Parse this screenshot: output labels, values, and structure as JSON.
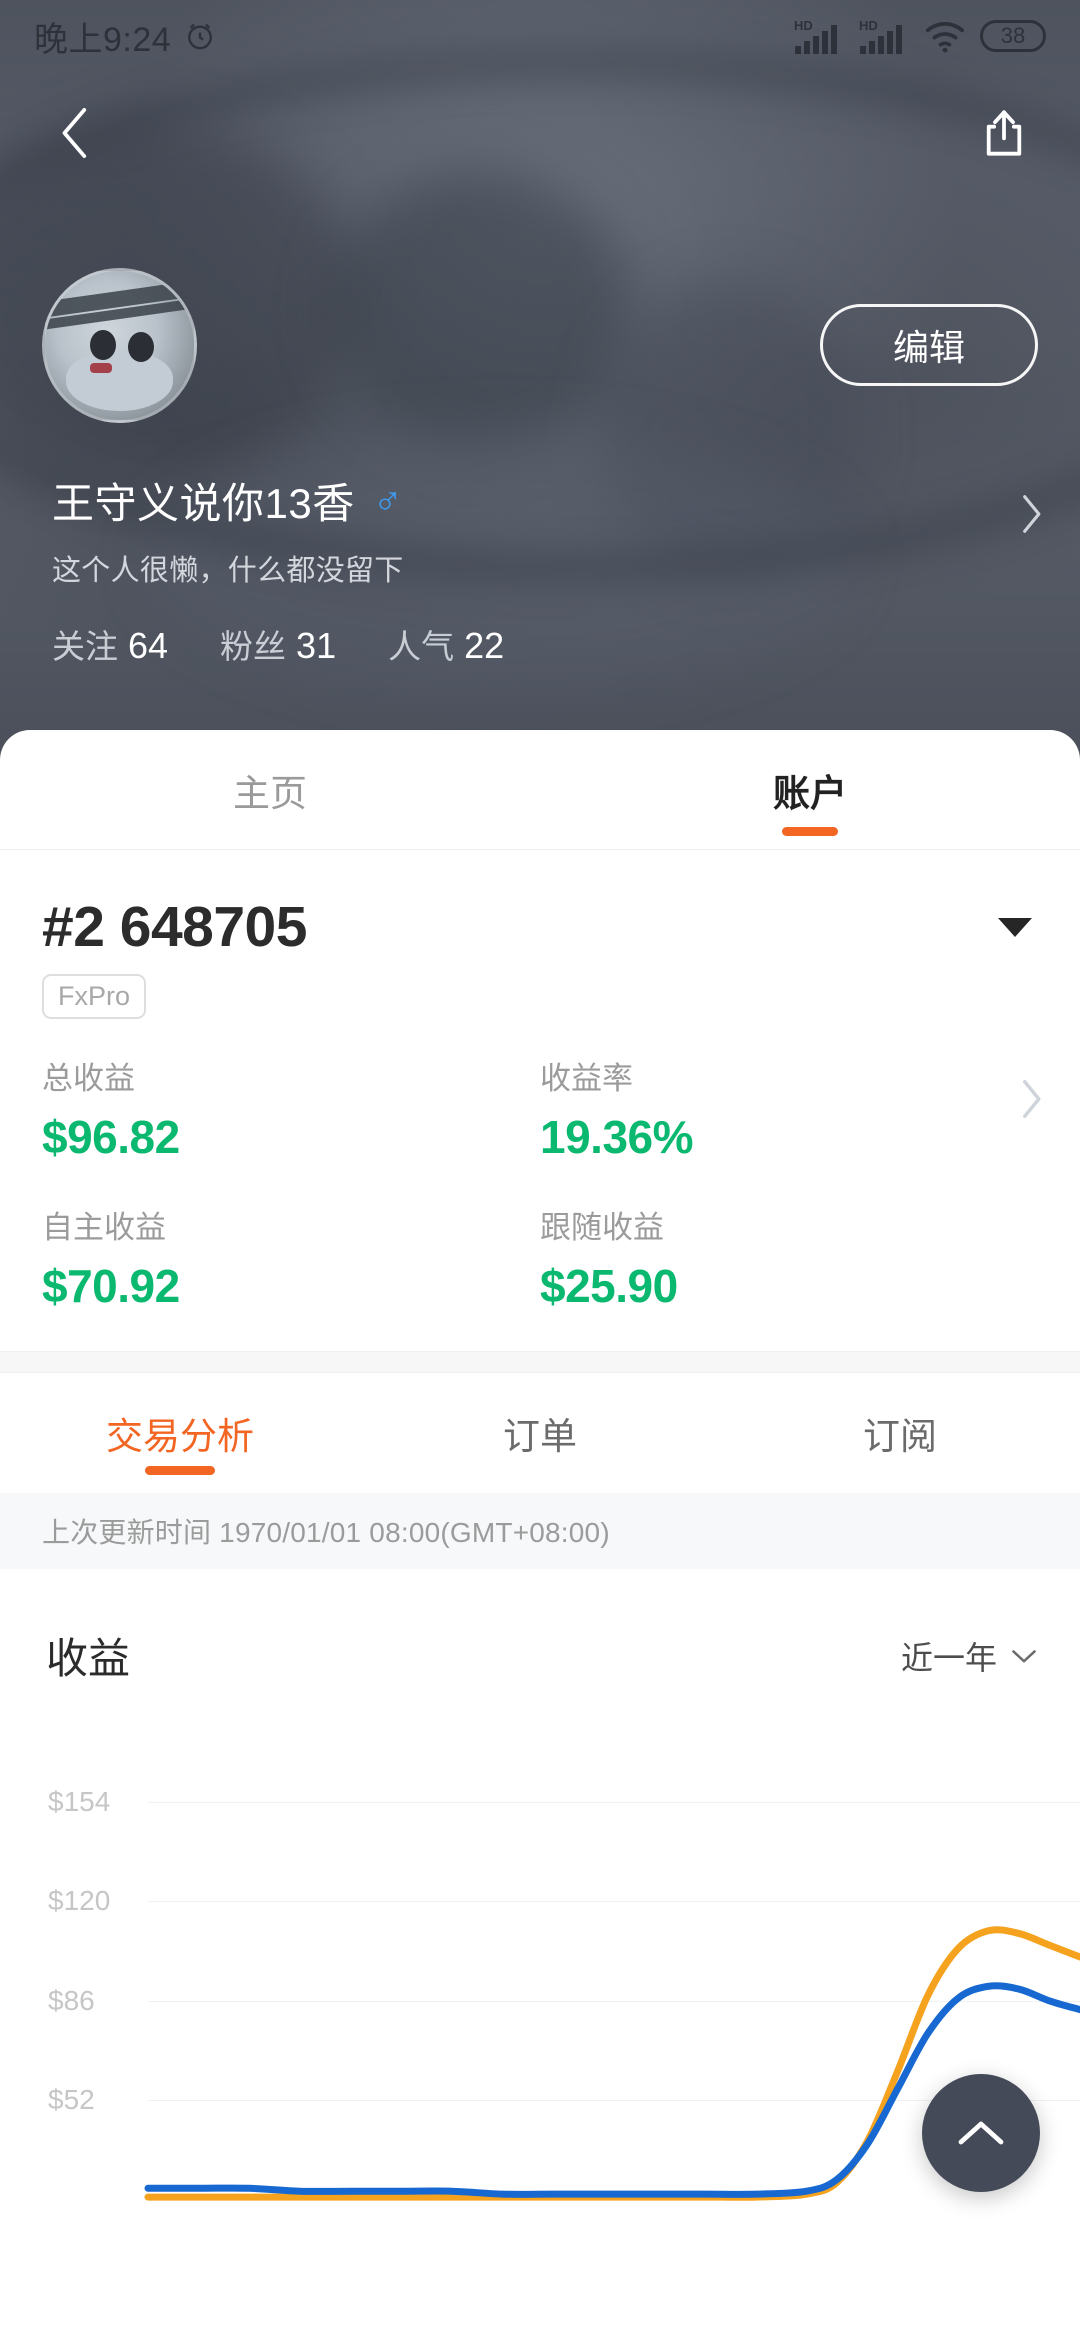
{
  "statusbar": {
    "time": "晚上9:24",
    "alarm_icon": "alarm-clock-icon",
    "signal_label": "HD",
    "battery": "38"
  },
  "nav": {
    "back_icon": "back-chevron-icon",
    "share_icon": "share-icon"
  },
  "profile": {
    "avatar_alt": "user-avatar",
    "edit_label": "编辑",
    "username": "王守义说你13香",
    "gender_symbol": "♂",
    "bio": "这个人很懒，什么都没留下",
    "stats": [
      {
        "label": "关注",
        "value": "64"
      },
      {
        "label": "粉丝",
        "value": "31"
      },
      {
        "label": "人气",
        "value": "22"
      }
    ]
  },
  "tabs": [
    {
      "label": "主页",
      "active": false
    },
    {
      "label": "账户",
      "active": true
    }
  ],
  "account": {
    "number": "#2 648705",
    "broker": "FxPro",
    "metrics": [
      {
        "label": "总收益",
        "value": "$96.82"
      },
      {
        "label": "收益率",
        "value": "19.36%"
      },
      {
        "label": "自主收益",
        "value": "$70.92"
      },
      {
        "label": "跟随收益",
        "value": "$25.90"
      }
    ],
    "metric_color": "#0ab870"
  },
  "subtabs": [
    {
      "label": "交易分析",
      "active": true
    },
    {
      "label": "订单",
      "active": false
    },
    {
      "label": "订阅",
      "active": false
    }
  ],
  "updated_text": "上次更新时间 1970/01/01 08:00(GMT+08:00)",
  "chart_header": {
    "title": "收益",
    "range": "近一年",
    "chevron_icon": "chevron-down-icon"
  },
  "fab": {
    "icon": "scroll-to-top-icon",
    "color": "#454a58"
  },
  "chart_data": {
    "type": "line",
    "title": "收益",
    "xlabel": "",
    "ylabel": "",
    "ylim": [
      18,
      171
    ],
    "ytick_labels": [
      "$154",
      "$120",
      "$86",
      "$52"
    ],
    "ytick_values": [
      154,
      120,
      86,
      52
    ],
    "grid": true,
    "legend_position": "none",
    "x": [
      0,
      5,
      10,
      15,
      20,
      25,
      30,
      35,
      40,
      45,
      50,
      55,
      60,
      65,
      68,
      71,
      74,
      77,
      80,
      83,
      86,
      89,
      92
    ],
    "series": [
      {
        "name": "跟随收益",
        "color": "#f5a21e",
        "values": [
          19,
          19,
          19,
          19,
          19,
          19,
          19,
          19,
          19,
          19,
          19,
          19,
          19,
          20,
          24,
          38,
          62,
          88,
          104,
          110,
          109,
          105,
          101
        ]
      },
      {
        "name": "自主收益",
        "color": "#1769d1",
        "values": [
          22,
          22,
          22,
          21,
          21,
          21,
          21,
          20,
          20,
          20,
          20,
          20,
          20,
          21,
          25,
          37,
          56,
          75,
          87,
          91,
          90,
          86,
          83
        ]
      }
    ]
  }
}
